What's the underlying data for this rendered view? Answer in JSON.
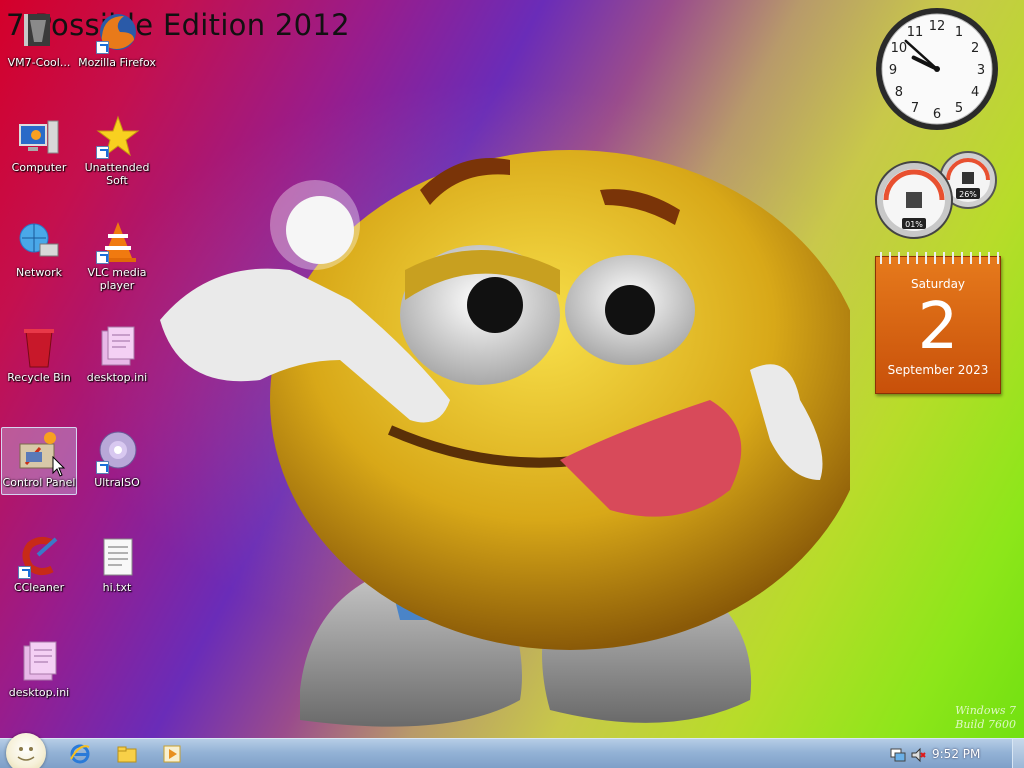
{
  "banner": {
    "text": "7 Possible Edition 2012"
  },
  "desktop_icons": [
    {
      "label": "VM7-Cool..."
    },
    {
      "label": "Mozilla Firefox"
    },
    {
      "label": "Computer"
    },
    {
      "label": "Unattended Soft"
    },
    {
      "label": "Network"
    },
    {
      "label": "VLC media player"
    },
    {
      "label": "Recycle Bin"
    },
    {
      "label": "desktop.ini"
    },
    {
      "label": "Control Panel"
    },
    {
      "label": "UltraISO"
    },
    {
      "label": "CCleaner"
    },
    {
      "label": "hi.txt"
    },
    {
      "label": "desktop.ini"
    }
  ],
  "clock_gadget": {
    "hour": 9,
    "minute": 52,
    "numbers": [
      "12",
      "1",
      "2",
      "3",
      "4",
      "5",
      "6",
      "7",
      "8",
      "9",
      "10",
      "11"
    ]
  },
  "cpu_meter": {
    "cpu_percent": "01%",
    "memory_percent": "26%"
  },
  "calendar": {
    "weekday": "Saturday",
    "day": "2",
    "month_year": "September 2023"
  },
  "watermark": {
    "line1": "Windows 7",
    "line2": "Build 7600"
  },
  "taskbar": {
    "pinned": [
      {
        "name": "internet-explorer"
      },
      {
        "name": "windows-explorer"
      },
      {
        "name": "media-player"
      }
    ],
    "tray_time": "9:52 PM"
  }
}
